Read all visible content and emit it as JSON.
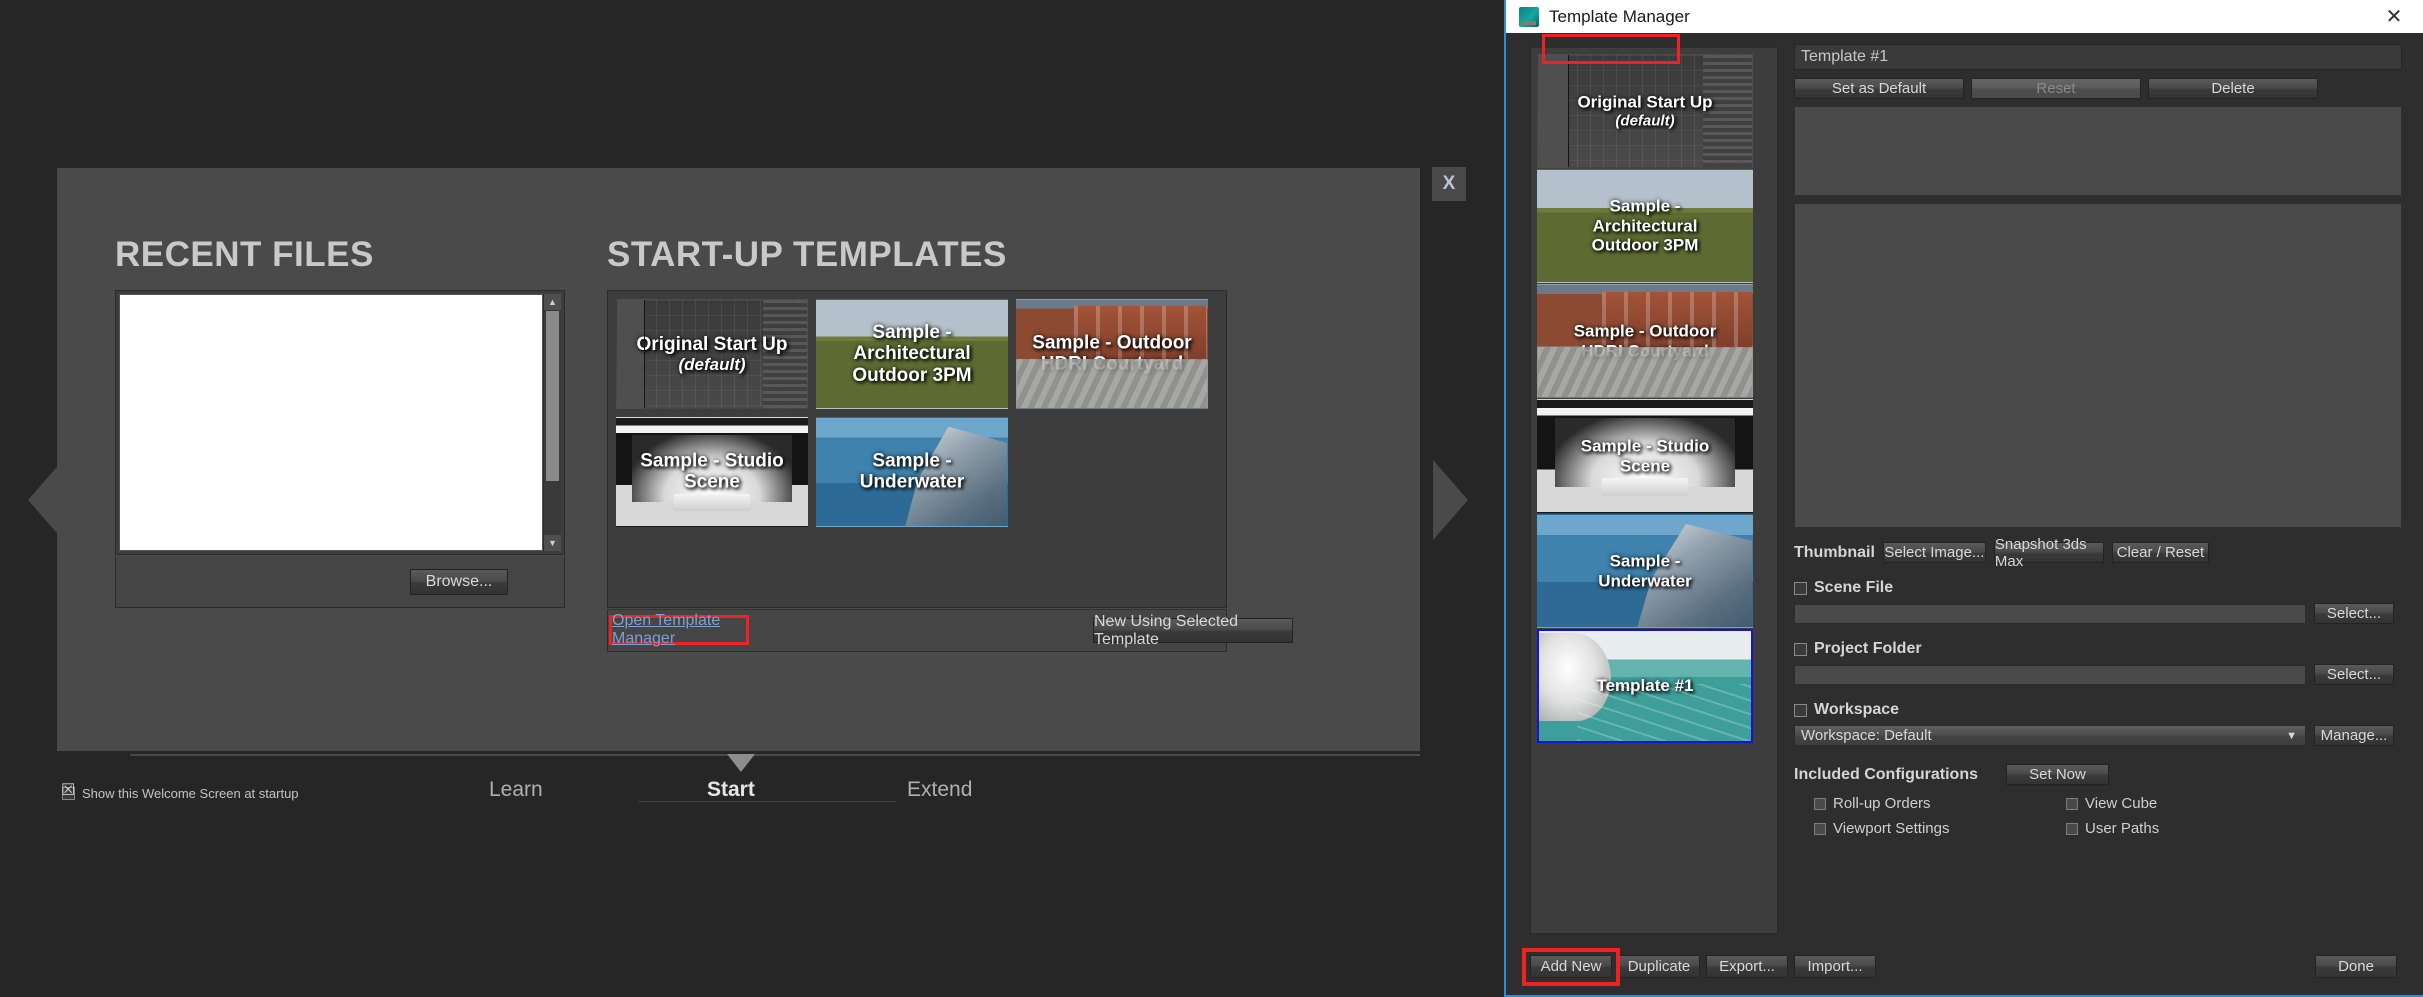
{
  "welcome": {
    "close_label": "X",
    "recent_files": {
      "title": "RECENT FILES",
      "browse_label": "Browse...",
      "items": []
    },
    "startup_templates": {
      "title": "START-UP TEMPLATES",
      "open_template_manager_label": "Open Template Manager",
      "new_using_selected_label": "New Using Selected Template",
      "cards": [
        {
          "label": "Original Start Up",
          "sublabel": "(default)",
          "art": "art-original"
        },
        {
          "label": "Sample - Architectural\nOutdoor 3PM",
          "sublabel": "",
          "art": "art-arch"
        },
        {
          "label": "Sample - Outdoor\nHDRI Courtyard",
          "sublabel": "",
          "art": "art-hdri"
        },
        {
          "label": "Sample - Studio Scene",
          "sublabel": "",
          "art": "art-studio"
        },
        {
          "label": "Sample - Underwater",
          "sublabel": "",
          "art": "art-under"
        }
      ]
    },
    "tabs": [
      {
        "label": "Learn",
        "active": false
      },
      {
        "label": "Start",
        "active": true
      },
      {
        "label": "Extend",
        "active": false
      }
    ],
    "show_at_startup": {
      "label": "Show this Welcome Screen at startup",
      "checked": true
    }
  },
  "template_manager": {
    "window_title": "Template Manager",
    "close_label": "✕",
    "list": [
      {
        "label": "Original Start Up",
        "sublabel": "(default)",
        "art": "art-original",
        "selected": false
      },
      {
        "label": "Sample -\nArchitectural\nOutdoor 3PM",
        "sublabel": "",
        "art": "art-arch",
        "selected": false
      },
      {
        "label": "Sample - Outdoor\nHDRI Courtyard",
        "sublabel": "",
        "art": "art-hdri",
        "selected": false
      },
      {
        "label": "Sample - Studio\nScene",
        "sublabel": "",
        "art": "art-studio",
        "selected": false
      },
      {
        "label": "Sample -\nUnderwater",
        "sublabel": "",
        "art": "art-under",
        "selected": false
      },
      {
        "label": "Template #1",
        "sublabel": "",
        "art": "art-tpl1",
        "selected": true
      }
    ],
    "name_field": {
      "value": "Template #1"
    },
    "top_buttons": {
      "set_as_default": "Set as Default",
      "reset": "Reset",
      "delete": "Delete"
    },
    "thumbnail": {
      "label": "Thumbnail",
      "select_image": "Select Image...",
      "snapshot": "Snapshot 3ds Max",
      "clear_reset": "Clear / Reset"
    },
    "scene_file": {
      "label": "Scene File",
      "checked": false,
      "value": "",
      "button": "Select..."
    },
    "project_folder": {
      "label": "Project Folder",
      "checked": false,
      "value": "",
      "button": "Select..."
    },
    "workspace": {
      "label": "Workspace",
      "checked": false,
      "selected": "Workspace: Default",
      "caret": "▼",
      "button": "Manage..."
    },
    "included_configurations": {
      "label": "Included Configurations",
      "set_now": "Set Now",
      "options": [
        {
          "label": "Roll-up Orders",
          "checked": false
        },
        {
          "label": "View Cube",
          "checked": false
        },
        {
          "label": "Viewport Settings",
          "checked": false
        },
        {
          "label": "User Paths",
          "checked": false
        }
      ]
    },
    "bottom_buttons": {
      "add_new": "Add New",
      "duplicate": "Duplicate",
      "export": "Export...",
      "import": "Import...",
      "done": "Done"
    }
  },
  "colors": {
    "highlight_red": "#ee2222",
    "selection_blue": "#1414d8",
    "window_border_blue": "#2a8fd6",
    "link_blue": "#7d9fd1"
  }
}
